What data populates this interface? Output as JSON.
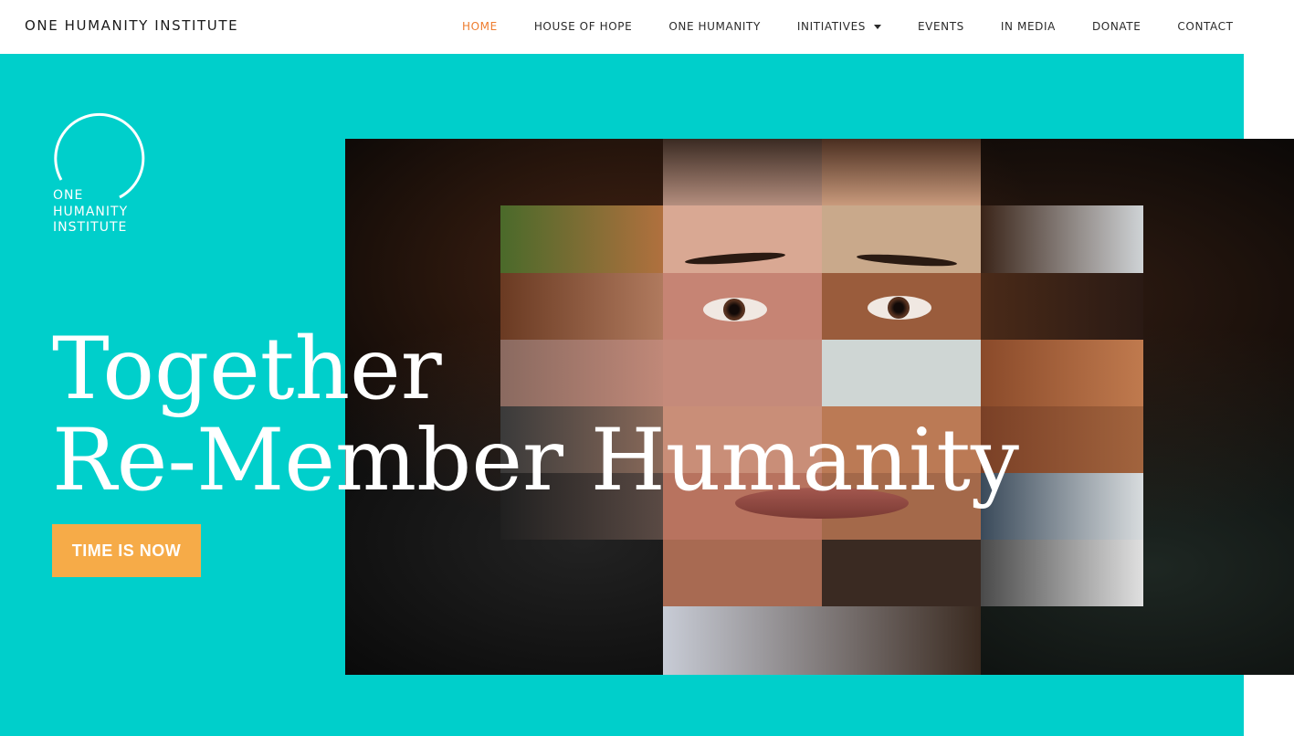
{
  "header": {
    "brand": "ONE HUMANITY INSTITUTE",
    "nav": [
      {
        "label": "HOME",
        "active": true
      },
      {
        "label": "HOUSE OF HOPE"
      },
      {
        "label": "ONE HUMANITY"
      },
      {
        "label": "INITIATIVES",
        "dropdown": true
      },
      {
        "label": "EVENTS"
      },
      {
        "label": "IN MEDIA"
      },
      {
        "label": "DONATE"
      },
      {
        "label": "CONTACT"
      }
    ]
  },
  "hero": {
    "logo": {
      "line1": "ONE",
      "line2": "HUMANITY",
      "line3": "INSTITUTE"
    },
    "headline_line1": "Together",
    "headline_line2": "Re-Member Humanity",
    "cta_label": "TIME IS NOW"
  },
  "colors": {
    "hero_bg": "#00cfcb",
    "cta_bg": "#f6ab48",
    "nav_active": "#ee7d2f",
    "text_dark": "#2b2b2b",
    "white": "#ffffff"
  },
  "icons": {
    "dropdown": "caret-down-icon",
    "logo": "open-circle-logo-icon"
  }
}
